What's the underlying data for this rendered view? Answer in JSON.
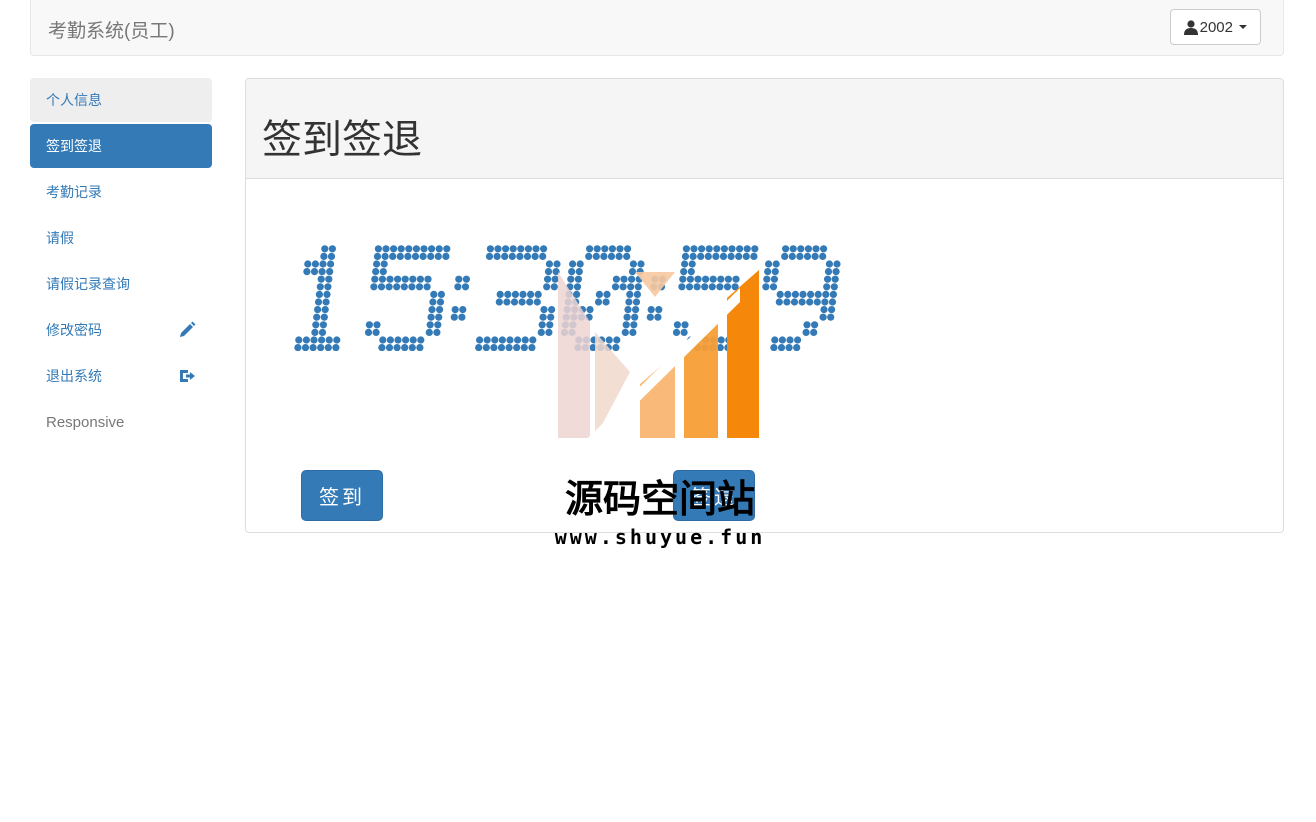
{
  "navbar": {
    "brand": "考勤系统(员工)",
    "user_label": "2002",
    "user_icon": "user-icon"
  },
  "sidebar": {
    "items": [
      {
        "label": "个人信息"
      },
      {
        "label": "签到签退"
      },
      {
        "label": "考勤记录"
      },
      {
        "label": "请假"
      },
      {
        "label": "请假记录查询"
      },
      {
        "label": "修改密码",
        "icon": "pencil-icon"
      },
      {
        "label": "退出系统",
        "icon": "logout-icon"
      },
      {
        "label": "Responsive"
      }
    ]
  },
  "main": {
    "title": "签到签退",
    "clock_time": "15:30:59",
    "sign_in_label": "签到",
    "sign_out_label": "签退"
  },
  "watermark": {
    "text": "源码空间站",
    "url": "www.shuyue.fun"
  },
  "colors": {
    "primary": "#337ab7",
    "accent_orange": "#f5870a"
  }
}
